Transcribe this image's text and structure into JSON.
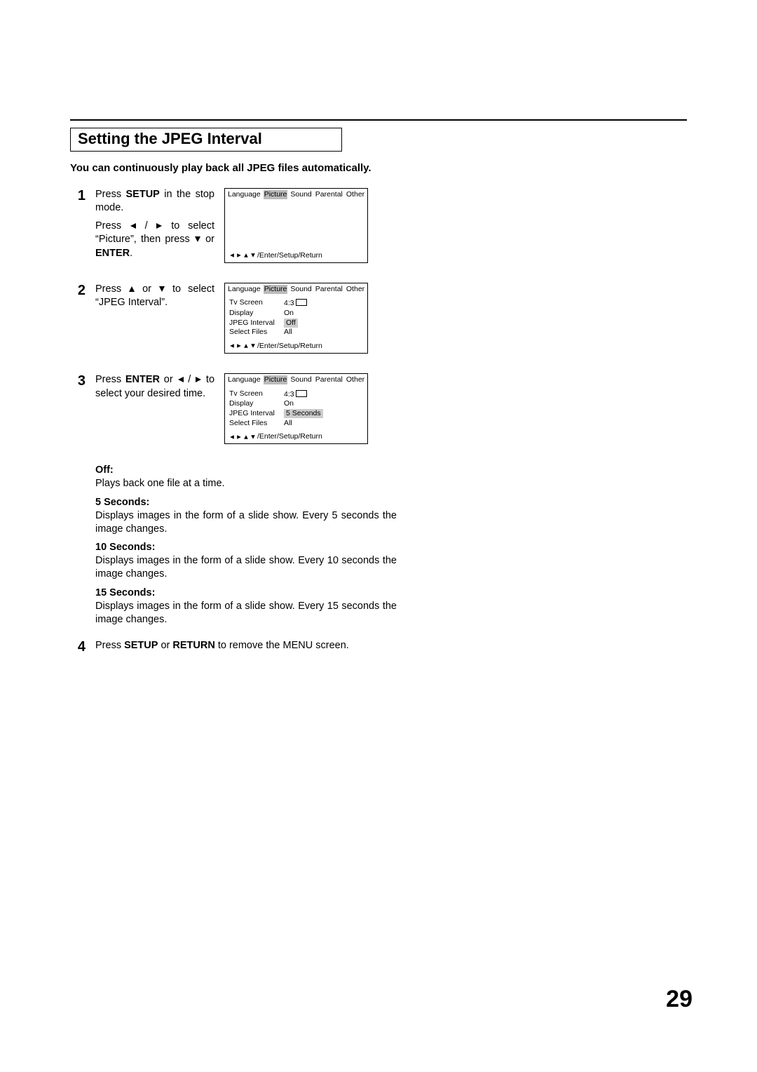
{
  "page_number": "29",
  "section_title": "Setting the JPEG Interval",
  "intro": "You can continuously play back all JPEG files automatically.",
  "steps": {
    "s1": {
      "num": "1",
      "line1a": "Press ",
      "line1b": "SETUP",
      "line1c": " in the stop mode.",
      "line2a": "Press ",
      "line2b": " / ",
      "line2c": " to select “Picture”, then press ",
      "line2d": " or ",
      "line2e": "ENTER",
      "line2f": "."
    },
    "s2": {
      "num": "2",
      "line1a": "Press ",
      "line1b": " or ",
      "line1c": " to select “JPEG Interval”."
    },
    "s3": {
      "num": "3",
      "line1a": "Press ",
      "line1b": "ENTER",
      "line1c": " or ",
      "line1d": " / ",
      "line1e": " to select your desired time."
    },
    "s4": {
      "num": "4",
      "line1a": "Press ",
      "line1b": "SETUP",
      "line1c": " or ",
      "line1d": "RETURN",
      "line1e": " to remove the MENU screen."
    }
  },
  "screen_tabs": {
    "t1": "Language",
    "t2": "Picture",
    "t3": "Sound",
    "t4": "Parental",
    "t5": "Other"
  },
  "screen_rows": {
    "r1c1": "Tv Screen",
    "r1c2": "4:3",
    "r2c1": "Display",
    "r2c2": "On",
    "r3c1": "JPEG Interval",
    "r3c2_off": "Off",
    "r3c2_5s": "5 Seconds",
    "r4c1": "Select Files",
    "r4c2": "All"
  },
  "screen_footer": "/Enter/Setup/Return",
  "options": {
    "off_t": "Off:",
    "off_b": "Plays back one file at a time.",
    "s5_t": "5 Seconds:",
    "s5_b": "Displays images in the form of a slide show. Every 5 seconds the image changes.",
    "s10_t": "10 Seconds:",
    "s10_b": "Displays images in the form of a slide show. Every 10 seconds the image changes.",
    "s15_t": "15 Seconds:",
    "s15_b": "Displays images in the form of a slide show. Every 15 seconds the image changes."
  }
}
